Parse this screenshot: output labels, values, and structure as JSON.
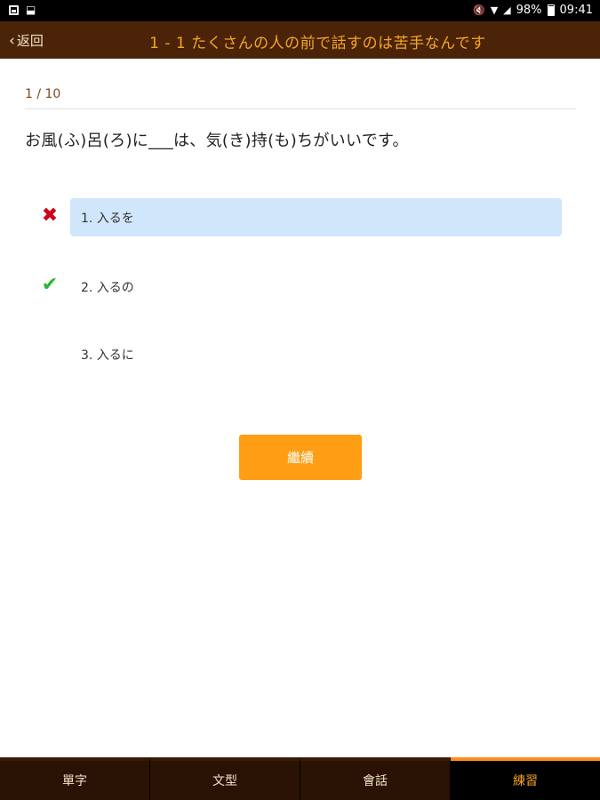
{
  "status_bar": {
    "left_icons": [
      "image-icon",
      "download-icon"
    ],
    "battery": "98%",
    "time": "09:41"
  },
  "header": {
    "back_label": "返回",
    "title": "1 - 1 たくさんの人の前で話すのは苦手なんです"
  },
  "quiz": {
    "progress": "1 / 10",
    "question": "お風(ふ)呂(ろ)に___は、気(き)持(も)ちがいいです。",
    "options": [
      {
        "label": "1. 入るを",
        "mark": "wrong",
        "mark_glyph": "✖",
        "selected": true
      },
      {
        "label": "2. 入るの",
        "mark": "correct",
        "mark_glyph": "✔",
        "selected": false
      },
      {
        "label": "3. 入るに",
        "mark": "",
        "mark_glyph": "",
        "selected": false
      }
    ],
    "continue_label": "繼續"
  },
  "tabs": [
    {
      "label": "單字",
      "active": false
    },
    {
      "label": "文型",
      "active": false
    },
    {
      "label": "會話",
      "active": false
    },
    {
      "label": "練習",
      "active": true
    }
  ],
  "colors": {
    "header_bg": "#4a2308",
    "accent": "#ff9d14",
    "selected_option_bg": "#cfe6fb",
    "wrong": "#d0021b",
    "correct": "#2ab530"
  }
}
